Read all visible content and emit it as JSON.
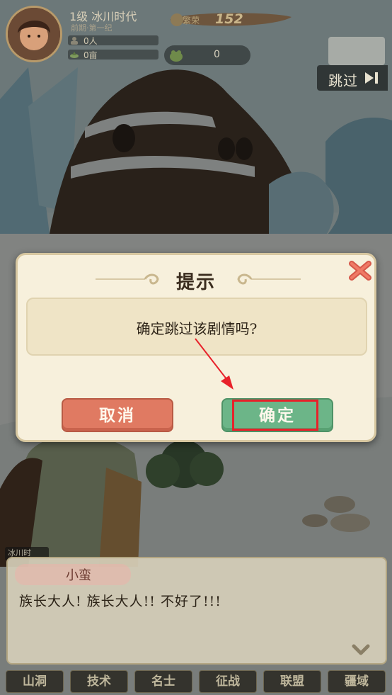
{
  "hud": {
    "level": "1级 冰川时代",
    "era": "前期·第一纪",
    "population": "0人",
    "land": "0亩",
    "prosperity_label": "繁荣",
    "prosperity_value": "152",
    "resource_value": "0",
    "skip_label": "跳过"
  },
  "dialog": {
    "title": "提示",
    "message": "确定跳过该剧情吗?",
    "cancel_label": "取消",
    "confirm_label": "确定"
  },
  "story": {
    "tab_label": "冰川时",
    "speaker": "小蛮",
    "text": "族长大人! 族长大人!! 不好了!!!"
  },
  "nav": {
    "items": [
      "山洞",
      "技术",
      "名士",
      "征战",
      "联盟",
      "疆域"
    ]
  },
  "colors": {
    "cancel": "#e07a62",
    "confirm": "#6cb588",
    "highlight": "#e8212a",
    "dialog_bg": "#f7f0dc"
  },
  "icons": [
    "close-icon",
    "skip-arrow-icon",
    "continue-icon",
    "mail-icon",
    "population-icon",
    "land-icon"
  ]
}
